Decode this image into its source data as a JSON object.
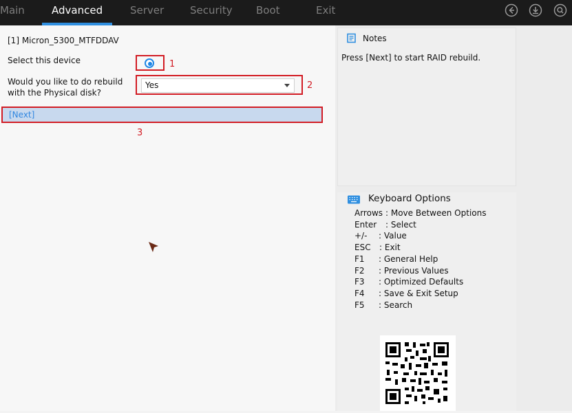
{
  "tabs": [
    {
      "label": "Main"
    },
    {
      "label": "Advanced"
    },
    {
      "label": "Server"
    },
    {
      "label": "Security"
    },
    {
      "label": "Boot"
    },
    {
      "label": "Exit"
    }
  ],
  "active_tab": "Advanced",
  "top_icons": [
    "back-icon",
    "download-icon",
    "search-icon"
  ],
  "form": {
    "device_title": "[1] Micron_5300_MTFDDAV",
    "select_device_label": "Select this device",
    "select_device_checked": true,
    "rebuild_label_line1": "Would you like to do rebuild",
    "rebuild_label_line2": "with the Physical disk?",
    "rebuild_value": "Yes",
    "next_label": "[Next]"
  },
  "annotations": {
    "n1": "1",
    "n2": "2",
    "n3": "3"
  },
  "notes": {
    "title": "Notes",
    "text": "Press [Next] to start RAID rebuild."
  },
  "keyboard": {
    "title": "Keyboard Options",
    "rows": [
      {
        "key": "Arrows",
        "desc": ": Move Between Options"
      },
      {
        "key": "Enter",
        "desc": ": Select"
      },
      {
        "key": "+/-",
        "desc": ": Value"
      },
      {
        "key": "ESC",
        "desc": ": Exit"
      },
      {
        "key": "F1",
        "desc": ": General Help"
      },
      {
        "key": "F2",
        "desc": ": Previous Values"
      },
      {
        "key": "F3",
        "desc": ": Optimized Defaults"
      },
      {
        "key": "F4",
        "desc": ": Save & Exit Setup"
      },
      {
        "key": "F5",
        "desc": ": Search"
      }
    ]
  },
  "colors": {
    "accent": "#2f8fe0",
    "highlight_border": "#d21b23",
    "topbar": "#1b1b1b"
  }
}
